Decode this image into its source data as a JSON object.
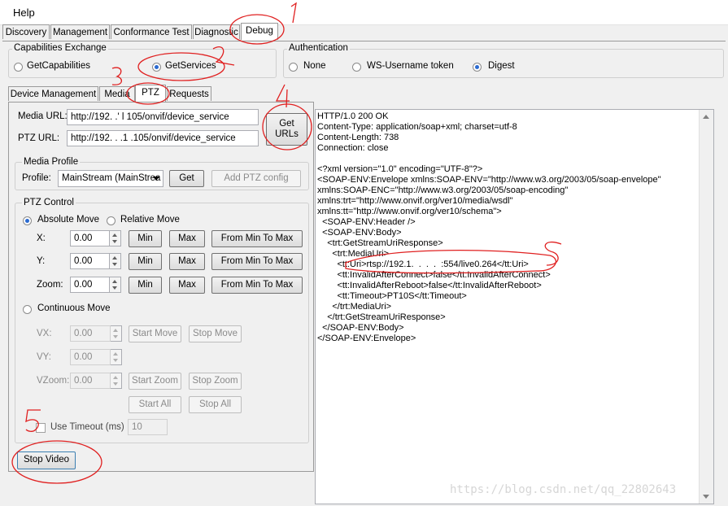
{
  "menu": {
    "help": "Help"
  },
  "main_tabs": [
    "Discovery",
    "Management",
    "Conformance Test",
    "Diagnostic",
    "Debug"
  ],
  "capabilities": {
    "legend": "Capabilities Exchange",
    "options": [
      "GetCapabilities",
      "GetServices"
    ],
    "selected": "GetServices"
  },
  "authentication": {
    "legend": "Authentication",
    "options": [
      "None",
      "WS-Username token",
      "Digest"
    ],
    "selected": "Digest"
  },
  "sub_tabs": [
    "Device Management",
    "Media",
    "PTZ",
    "Requests"
  ],
  "urls": {
    "media_label": "Media URL:",
    "media_value": "http://192.  .'  l  105/onvif/device_service",
    "ptz_label": "PTZ URL:",
    "ptz_value": "http://192.  . .1  .105/onvif/device_service",
    "get_urls_button": "Get\nURLs"
  },
  "media_profile": {
    "legend": "Media Profile",
    "profile_label": "Profile:",
    "profile_value": "MainStream (MainStrea",
    "get_button": "Get",
    "add_ptz_button": "Add PTZ config"
  },
  "ptz_control": {
    "legend": "PTZ Control",
    "absolute_move": "Absolute Move",
    "relative_move": "Relative Move",
    "axes": [
      {
        "label": "X:",
        "value": "0.00"
      },
      {
        "label": "Y:",
        "value": "0.00"
      },
      {
        "label": "Zoom:",
        "value": "0.00"
      }
    ],
    "min_button": "Min",
    "max_button": "Max",
    "from_min_to_max_button": "From Min To Max",
    "continuous_move": "Continuous Move",
    "continuous_axes": [
      {
        "label": "VX:",
        "value": "0.00"
      },
      {
        "label": "VY:",
        "value": "0.00"
      },
      {
        "label": "VZoom:",
        "value": "0.00"
      }
    ],
    "start_move": "Start Move",
    "stop_move": "Stop Move",
    "start_zoom": "Start Zoom",
    "stop_zoom": "Stop Zoom",
    "start_all": "Start All",
    "stop_all": "Stop All",
    "use_timeout_label": "Use Timeout (ms)",
    "timeout_value": "10"
  },
  "stop_video_button": "Stop Video",
  "response_lines": [
    "HTTP/1.0 200 OK",
    "Content-Type: application/soap+xml; charset=utf-8",
    "Content-Length: 738",
    "Connection: close",
    "",
    "<?xml version=\"1.0\" encoding=\"UTF-8\"?>",
    "<SOAP-ENV:Envelope xmlns:SOAP-ENV=\"http://www.w3.org/2003/05/soap-envelope\"",
    "xmlns:SOAP-ENC=\"http://www.w3.org/2003/05/soap-encoding\"",
    "xmlns:trt=\"http://www.onvif.org/ver10/media/wsdl\"",
    "xmlns:tt=\"http://www.onvif.org/ver10/schema\">",
    "  <SOAP-ENV:Header />",
    "  <SOAP-ENV:Body>",
    "    <trt:GetStreamUriResponse>",
    "      <trt:MediaUri>",
    "        <tt:Uri>rtsp://192.1.  .  .  .  :554/live0.264</tt:Uri>",
    "        <tt:InvalidAfterConnect>false</tt:InvalidAfterConnect>",
    "        <tt:InvalidAfterReboot>false</tt:InvalidAfterReboot>",
    "        <tt:Timeout>PT10S</tt:Timeout>",
    "      </trt:MediaUri>",
    "    </trt:GetStreamUriResponse>",
    "  </SOAP-ENV:Body>",
    "</SOAP-ENV:Envelope>"
  ],
  "annotations": [
    "1",
    "2",
    "3",
    "4",
    "5"
  ],
  "watermark": "https://blog.csdn.net/qq_22802643",
  "colors": {
    "annotation_red": "#e02020",
    "window_bg": "#f0f0f0",
    "radio_dot": "#2a6ad1"
  }
}
